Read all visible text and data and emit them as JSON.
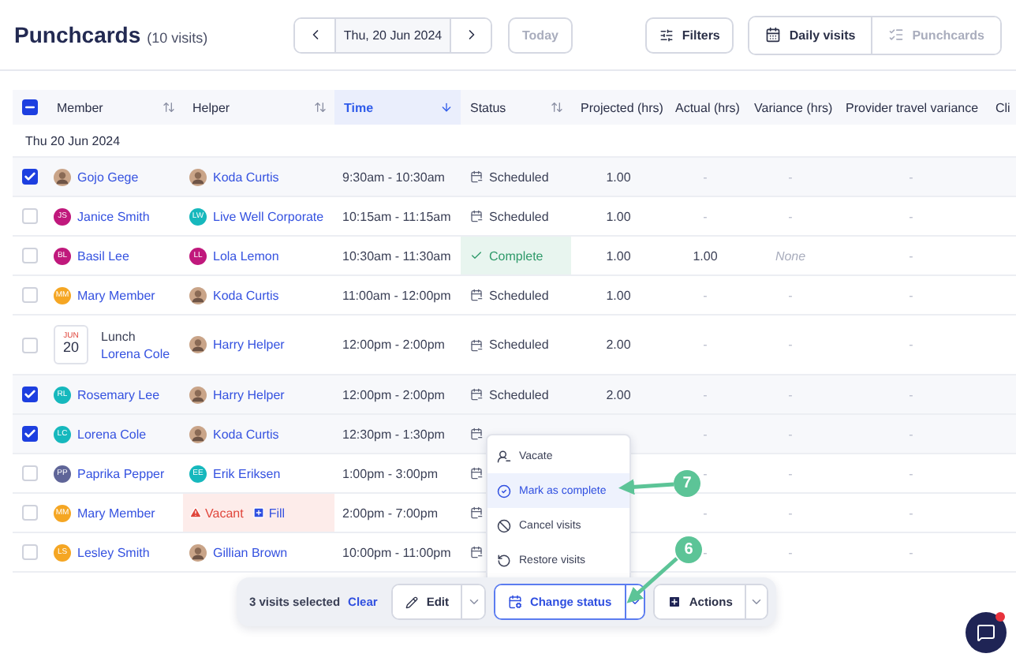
{
  "header": {
    "title": "Punchcards",
    "count": "(10 visits)",
    "date": "Thu, 20 Jun 2024",
    "today": {
      "label": "Today",
      "disabled": true
    },
    "filters": "Filters",
    "views": [
      {
        "label": "Daily visits",
        "selected": true
      },
      {
        "label": "Punchcards",
        "selected": false
      }
    ]
  },
  "table": {
    "select_all": {
      "indeterminate": true
    },
    "columns": [
      {
        "label": "Member",
        "sortable": true,
        "sorted": false,
        "selected": false
      },
      {
        "label": "Helper",
        "sortable": true,
        "sorted": false,
        "selected": false
      },
      {
        "label": "Time",
        "sortable": true,
        "sorted": true,
        "selected": true
      },
      {
        "label": "Status",
        "sortable": true,
        "sorted": false,
        "selected": false
      },
      {
        "label": "Projected (hrs)",
        "selected": false
      },
      {
        "label": "Actual (hrs)",
        "selected": false
      },
      {
        "label": "Variance (hrs)",
        "selected": false
      },
      {
        "label": "Provider travel variance",
        "selected": false
      },
      {
        "label": "Cli",
        "selected": false
      }
    ],
    "group": "Thu 20 Jun 2024",
    "rows": [
      {
        "checked": true,
        "member": {
          "kind": "person",
          "name": "Gojo Gege",
          "avatar": {
            "kind": "photo"
          }
        },
        "helper": {
          "kind": "person",
          "name": "Koda Curtis",
          "avatar": {
            "kind": "photo"
          }
        },
        "time": "9:30am - 10:30am",
        "status": {
          "kind": "scheduled",
          "label": "Scheduled"
        },
        "projected": "1.00",
        "actual": "-",
        "variance": {
          "kind": "dash",
          "text": "-"
        },
        "travel": "-"
      },
      {
        "checked": false,
        "member": {
          "kind": "person",
          "name": "Janice Smith",
          "avatar": {
            "kind": "initials",
            "initials": "JS",
            "color": "#c0187c"
          }
        },
        "helper": {
          "kind": "person",
          "name": "Live Well Corporate",
          "avatar": {
            "kind": "initials",
            "initials": "LW",
            "color": "#16b8bd"
          }
        },
        "time": "10:15am - 11:15am",
        "status": {
          "kind": "scheduled",
          "label": "Scheduled"
        },
        "projected": "1.00",
        "actual": "-",
        "variance": {
          "kind": "dash",
          "text": "-"
        },
        "travel": "-"
      },
      {
        "checked": false,
        "member": {
          "kind": "person",
          "name": "Basil Lee",
          "avatar": {
            "kind": "initials",
            "initials": "BL",
            "color": "#c0187c"
          }
        },
        "helper": {
          "kind": "person",
          "name": "Lola Lemon",
          "avatar": {
            "kind": "initials",
            "initials": "LL",
            "color": "#c0187c"
          }
        },
        "time": "10:30am - 11:30am",
        "status": {
          "kind": "complete",
          "label": "Complete"
        },
        "projected": "1.00",
        "actual": "1.00",
        "variance": {
          "kind": "none",
          "text": "None"
        },
        "travel": "-"
      },
      {
        "checked": false,
        "member": {
          "kind": "person",
          "name": "Mary Member",
          "avatar": {
            "kind": "initials",
            "initials": "MM",
            "color": "#f5a623"
          }
        },
        "helper": {
          "kind": "person",
          "name": "Koda Curtis",
          "avatar": {
            "kind": "photo"
          }
        },
        "time": "11:00am - 12:00pm",
        "status": {
          "kind": "scheduled",
          "label": "Scheduled"
        },
        "projected": "1.00",
        "actual": "-",
        "variance": {
          "kind": "dash",
          "text": "-"
        },
        "travel": "-"
      },
      {
        "checked": false,
        "member": {
          "kind": "lunch",
          "month": "JUN",
          "day": "20",
          "title": "Lunch",
          "name": "Lorena Cole"
        },
        "helper": {
          "kind": "person",
          "name": "Harry Helper",
          "avatar": {
            "kind": "photo"
          }
        },
        "time": "12:00pm - 2:00pm",
        "status": {
          "kind": "scheduled",
          "label": "Scheduled"
        },
        "projected": "2.00",
        "actual": "-",
        "variance": {
          "kind": "dash",
          "text": "-"
        },
        "travel": "-"
      },
      {
        "checked": true,
        "member": {
          "kind": "person",
          "name": "Rosemary Lee",
          "avatar": {
            "kind": "initials",
            "initials": "RL",
            "color": "#16b8bd"
          }
        },
        "helper": {
          "kind": "person",
          "name": "Harry Helper",
          "avatar": {
            "kind": "photo"
          }
        },
        "time": "12:00pm - 2:00pm",
        "status": {
          "kind": "scheduled",
          "label": "Scheduled"
        },
        "projected": "2.00",
        "actual": "-",
        "variance": {
          "kind": "dash",
          "text": "-"
        },
        "travel": "-"
      },
      {
        "checked": true,
        "member": {
          "kind": "person",
          "name": "Lorena Cole",
          "avatar": {
            "kind": "initials",
            "initials": "LC",
            "color": "#16b8bd"
          }
        },
        "helper": {
          "kind": "person",
          "name": "Koda Curtis",
          "avatar": {
            "kind": "photo"
          }
        },
        "time": "12:30pm - 1:30pm",
        "status": {
          "kind": "scheduled"
        },
        "actual": "-",
        "variance": {
          "kind": "dash",
          "text": "-"
        },
        "travel": "-"
      },
      {
        "checked": false,
        "member": {
          "kind": "person",
          "name": "Paprika Pepper",
          "avatar": {
            "kind": "initials",
            "initials": "PP",
            "color": "#5f6598"
          }
        },
        "helper": {
          "kind": "person",
          "name": "Erik Eriksen",
          "avatar": {
            "kind": "initials",
            "initials": "EE",
            "color": "#16b8bd"
          }
        },
        "time": "1:00pm - 3:00pm",
        "status": {
          "kind": "scheduled"
        },
        "actual": "-",
        "variance": {
          "kind": "dash",
          "text": "-"
        },
        "travel": "-"
      },
      {
        "checked": false,
        "member": {
          "kind": "person",
          "name": "Mary Member",
          "avatar": {
            "kind": "initials",
            "initials": "MM",
            "color": "#f5a623"
          }
        },
        "helper": {
          "kind": "vacant",
          "label": "Vacant",
          "action": "Fill"
        },
        "time": "2:00pm - 7:00pm",
        "status": {
          "kind": "scheduled"
        },
        "actual": "-",
        "variance": {
          "kind": "dash",
          "text": "-"
        },
        "travel": "-"
      },
      {
        "checked": false,
        "member": {
          "kind": "person",
          "name": "Lesley Smith",
          "avatar": {
            "kind": "initials",
            "initials": "LS",
            "color": "#f5a623"
          }
        },
        "helper": {
          "kind": "person",
          "name": "Gillian Brown",
          "avatar": {
            "kind": "photo"
          }
        },
        "time": "10:00pm - 11:00pm",
        "status": {
          "kind": "scheduled"
        },
        "actual": "-",
        "variance": {
          "kind": "dash",
          "text": "-"
        },
        "travel": "-"
      }
    ]
  },
  "status_menu": [
    {
      "kind": "vacate",
      "label": "Vacate",
      "selected": false
    },
    {
      "kind": "complete",
      "label": "Mark as complete",
      "selected": true
    },
    {
      "kind": "cancel",
      "label": "Cancel visits",
      "selected": false
    },
    {
      "kind": "restore",
      "label": "Restore visits",
      "selected": false
    }
  ],
  "bulk_bar": {
    "selection": "3 visits selected",
    "clear": "Clear",
    "buttons": [
      {
        "kind": "edit",
        "label": "Edit",
        "expanded": false
      },
      {
        "kind": "status",
        "label": "Change status",
        "expanded": true
      },
      {
        "kind": "actions",
        "label": "Actions",
        "expanded": false
      }
    ]
  },
  "annotations": [
    {
      "label": "7"
    },
    {
      "label": "6"
    }
  ],
  "chat": {
    "unread": true
  }
}
